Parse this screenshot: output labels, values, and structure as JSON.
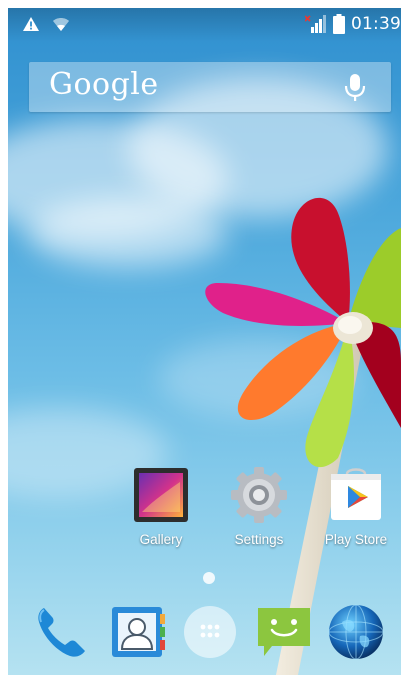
{
  "status_bar": {
    "time": "01:39",
    "icons": [
      "warning-icon",
      "wifi-icon",
      "no-signal-icon",
      "battery-icon"
    ]
  },
  "search_widget": {
    "logo_text": "Google",
    "icon": "mic-icon"
  },
  "home_apps": [
    {
      "label": "Gallery",
      "icon": "gallery-icon"
    },
    {
      "label": "Settings",
      "icon": "settings-icon"
    },
    {
      "label": "Play Store",
      "icon": "play-store-icon"
    }
  ],
  "dock": [
    {
      "name": "Phone",
      "icon": "phone-icon"
    },
    {
      "name": "Contacts",
      "icon": "contacts-icon"
    },
    {
      "name": "App drawer",
      "icon": "app-drawer-icon"
    },
    {
      "name": "Messaging",
      "icon": "messaging-icon"
    },
    {
      "name": "Browser",
      "icon": "globe-icon"
    }
  ],
  "colors": {
    "sky_top": "#2f8fcf",
    "sky_bottom": "#b5e2f1",
    "messaging_green": "#8cc63f",
    "phone_blue": "#1e88d6"
  }
}
